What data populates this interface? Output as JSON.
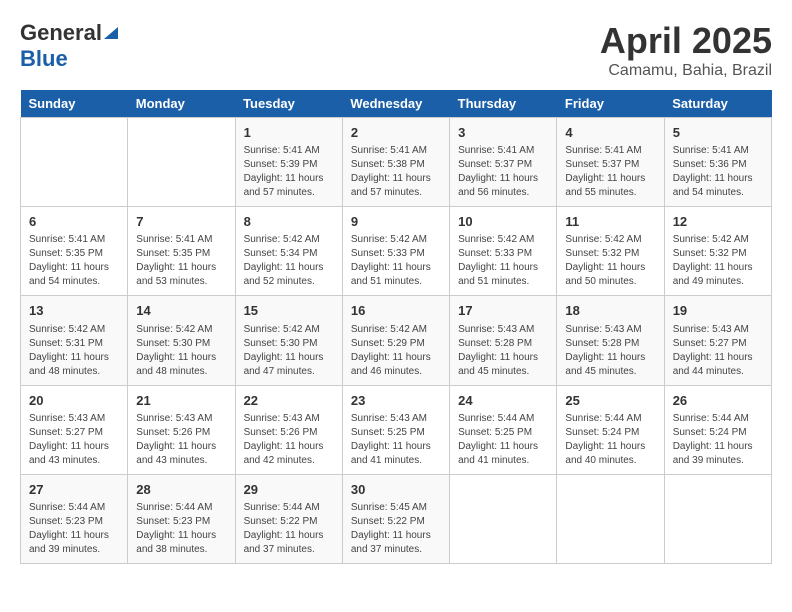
{
  "header": {
    "logo_general": "General",
    "logo_blue": "Blue",
    "month": "April 2025",
    "location": "Camamu, Bahia, Brazil"
  },
  "weekdays": [
    "Sunday",
    "Monday",
    "Tuesday",
    "Wednesday",
    "Thursday",
    "Friday",
    "Saturday"
  ],
  "weeks": [
    [
      {
        "day": "",
        "info": ""
      },
      {
        "day": "",
        "info": ""
      },
      {
        "day": "1",
        "info": "Sunrise: 5:41 AM\nSunset: 5:39 PM\nDaylight: 11 hours and 57 minutes."
      },
      {
        "day": "2",
        "info": "Sunrise: 5:41 AM\nSunset: 5:38 PM\nDaylight: 11 hours and 57 minutes."
      },
      {
        "day": "3",
        "info": "Sunrise: 5:41 AM\nSunset: 5:37 PM\nDaylight: 11 hours and 56 minutes."
      },
      {
        "day": "4",
        "info": "Sunrise: 5:41 AM\nSunset: 5:37 PM\nDaylight: 11 hours and 55 minutes."
      },
      {
        "day": "5",
        "info": "Sunrise: 5:41 AM\nSunset: 5:36 PM\nDaylight: 11 hours and 54 minutes."
      }
    ],
    [
      {
        "day": "6",
        "info": "Sunrise: 5:41 AM\nSunset: 5:35 PM\nDaylight: 11 hours and 54 minutes."
      },
      {
        "day": "7",
        "info": "Sunrise: 5:41 AM\nSunset: 5:35 PM\nDaylight: 11 hours and 53 minutes."
      },
      {
        "day": "8",
        "info": "Sunrise: 5:42 AM\nSunset: 5:34 PM\nDaylight: 11 hours and 52 minutes."
      },
      {
        "day": "9",
        "info": "Sunrise: 5:42 AM\nSunset: 5:33 PM\nDaylight: 11 hours and 51 minutes."
      },
      {
        "day": "10",
        "info": "Sunrise: 5:42 AM\nSunset: 5:33 PM\nDaylight: 11 hours and 51 minutes."
      },
      {
        "day": "11",
        "info": "Sunrise: 5:42 AM\nSunset: 5:32 PM\nDaylight: 11 hours and 50 minutes."
      },
      {
        "day": "12",
        "info": "Sunrise: 5:42 AM\nSunset: 5:32 PM\nDaylight: 11 hours and 49 minutes."
      }
    ],
    [
      {
        "day": "13",
        "info": "Sunrise: 5:42 AM\nSunset: 5:31 PM\nDaylight: 11 hours and 48 minutes."
      },
      {
        "day": "14",
        "info": "Sunrise: 5:42 AM\nSunset: 5:30 PM\nDaylight: 11 hours and 48 minutes."
      },
      {
        "day": "15",
        "info": "Sunrise: 5:42 AM\nSunset: 5:30 PM\nDaylight: 11 hours and 47 minutes."
      },
      {
        "day": "16",
        "info": "Sunrise: 5:42 AM\nSunset: 5:29 PM\nDaylight: 11 hours and 46 minutes."
      },
      {
        "day": "17",
        "info": "Sunrise: 5:43 AM\nSunset: 5:28 PM\nDaylight: 11 hours and 45 minutes."
      },
      {
        "day": "18",
        "info": "Sunrise: 5:43 AM\nSunset: 5:28 PM\nDaylight: 11 hours and 45 minutes."
      },
      {
        "day": "19",
        "info": "Sunrise: 5:43 AM\nSunset: 5:27 PM\nDaylight: 11 hours and 44 minutes."
      }
    ],
    [
      {
        "day": "20",
        "info": "Sunrise: 5:43 AM\nSunset: 5:27 PM\nDaylight: 11 hours and 43 minutes."
      },
      {
        "day": "21",
        "info": "Sunrise: 5:43 AM\nSunset: 5:26 PM\nDaylight: 11 hours and 43 minutes."
      },
      {
        "day": "22",
        "info": "Sunrise: 5:43 AM\nSunset: 5:26 PM\nDaylight: 11 hours and 42 minutes."
      },
      {
        "day": "23",
        "info": "Sunrise: 5:43 AM\nSunset: 5:25 PM\nDaylight: 11 hours and 41 minutes."
      },
      {
        "day": "24",
        "info": "Sunrise: 5:44 AM\nSunset: 5:25 PM\nDaylight: 11 hours and 41 minutes."
      },
      {
        "day": "25",
        "info": "Sunrise: 5:44 AM\nSunset: 5:24 PM\nDaylight: 11 hours and 40 minutes."
      },
      {
        "day": "26",
        "info": "Sunrise: 5:44 AM\nSunset: 5:24 PM\nDaylight: 11 hours and 39 minutes."
      }
    ],
    [
      {
        "day": "27",
        "info": "Sunrise: 5:44 AM\nSunset: 5:23 PM\nDaylight: 11 hours and 39 minutes."
      },
      {
        "day": "28",
        "info": "Sunrise: 5:44 AM\nSunset: 5:23 PM\nDaylight: 11 hours and 38 minutes."
      },
      {
        "day": "29",
        "info": "Sunrise: 5:44 AM\nSunset: 5:22 PM\nDaylight: 11 hours and 37 minutes."
      },
      {
        "day": "30",
        "info": "Sunrise: 5:45 AM\nSunset: 5:22 PM\nDaylight: 11 hours and 37 minutes."
      },
      {
        "day": "",
        "info": ""
      },
      {
        "day": "",
        "info": ""
      },
      {
        "day": "",
        "info": ""
      }
    ]
  ]
}
